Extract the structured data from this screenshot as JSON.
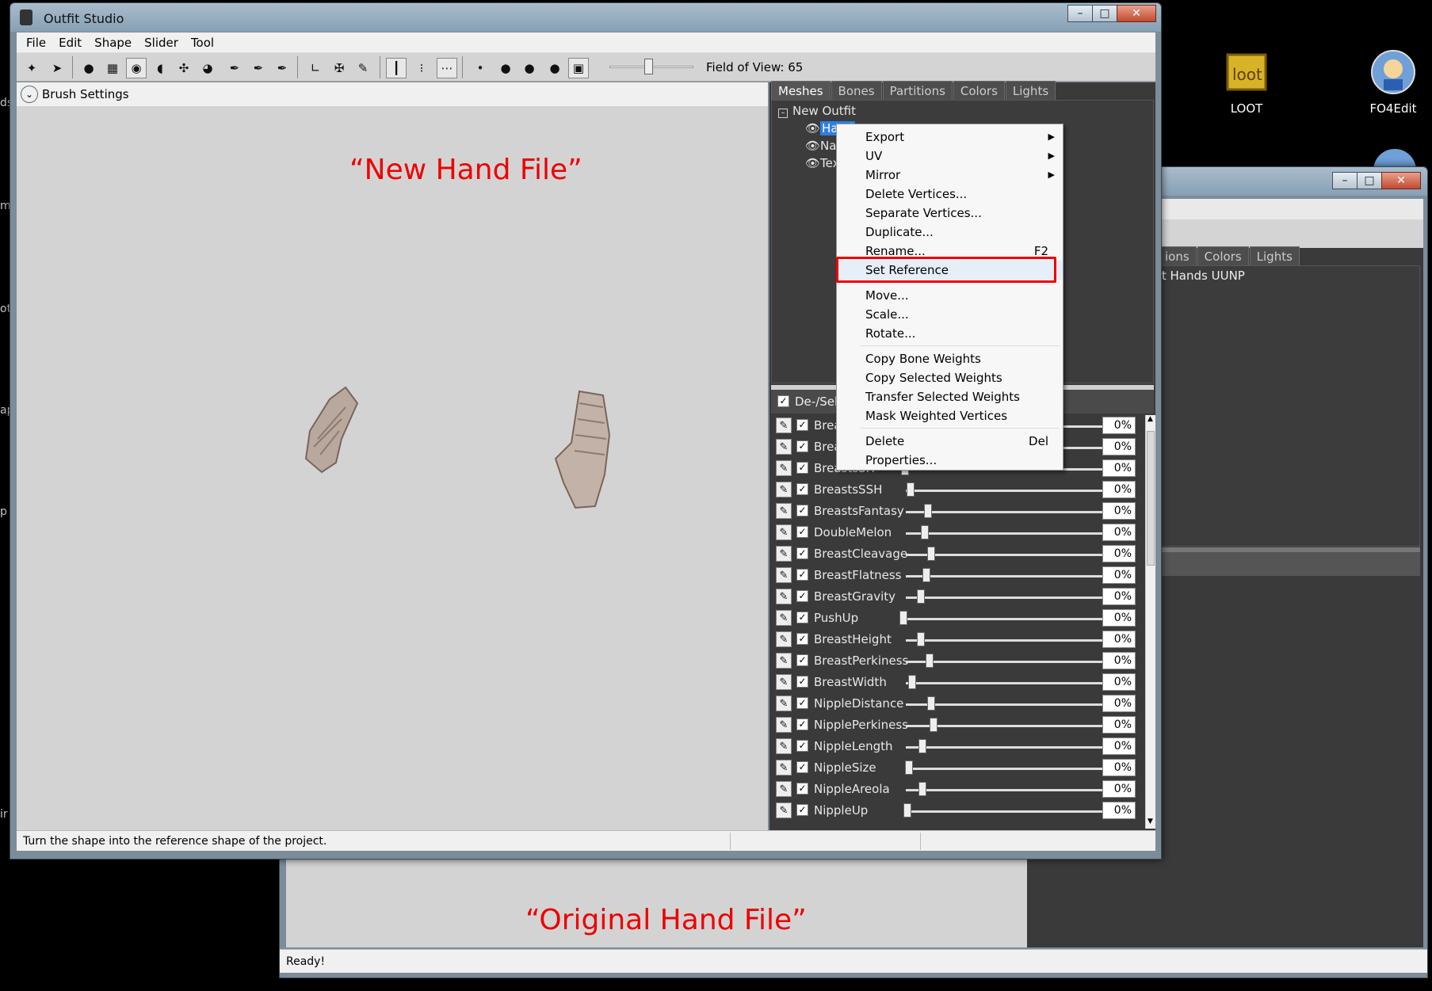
{
  "desktop": {
    "icons": [
      {
        "label": "LOOT"
      },
      {
        "label": "FO4Edit"
      }
    ],
    "edge_fragments": [
      "ds",
      "m",
      "ot",
      "ap",
      "p",
      "ir"
    ]
  },
  "main_window": {
    "title": "Outfit Studio",
    "menu": [
      "File",
      "Edit",
      "Shape",
      "Slider",
      "Tool"
    ],
    "field_of_view": "Field of View: 65",
    "field_of_view_value": 65,
    "brush_settings": "Brush Settings",
    "annotation": "“New Hand File”",
    "status_text": "Turn the shape into the reference shape of the project.",
    "tabs": [
      "Meshes",
      "Bones",
      "Partitions",
      "Colors",
      "Lights"
    ],
    "active_tab": "Meshes",
    "tree": {
      "root": "New Outfit",
      "items": [
        "Hand",
        "Nai",
        "Tex"
      ]
    },
    "select_all_label": "De-/Sele",
    "sliders": [
      {
        "name": "Breas",
        "value": "0%"
      },
      {
        "name": "Breas",
        "value": "0%"
      },
      {
        "name": "BreastsSH",
        "value": "0%"
      },
      {
        "name": "BreastsSSH",
        "value": "0%"
      },
      {
        "name": "BreastsFantasy",
        "value": "0%"
      },
      {
        "name": "DoubleMelon",
        "value": "0%"
      },
      {
        "name": "BreastCleavage",
        "value": "0%"
      },
      {
        "name": "BreastFlatness",
        "value": "0%"
      },
      {
        "name": "BreastGravity",
        "value": "0%"
      },
      {
        "name": "PushUp",
        "value": "0%"
      },
      {
        "name": "BreastHeight",
        "value": "0%"
      },
      {
        "name": "BreastPerkiness",
        "value": "0%"
      },
      {
        "name": "BreastWidth",
        "value": "0%"
      },
      {
        "name": "NippleDistance",
        "value": "0%"
      },
      {
        "name": "NipplePerkiness",
        "value": "0%"
      },
      {
        "name": "NippleLength",
        "value": "0%"
      },
      {
        "name": "NippleSize",
        "value": "0%"
      },
      {
        "name": "NippleAreola",
        "value": "0%"
      },
      {
        "name": "NippleUp",
        "value": "0%"
      }
    ]
  },
  "context_menu": {
    "items": [
      {
        "label": "Export",
        "submenu": true
      },
      {
        "label": "UV",
        "submenu": true
      },
      {
        "label": "Mirror",
        "submenu": true
      },
      {
        "label": "Delete Vertices..."
      },
      {
        "label": "Separate Vertices..."
      },
      {
        "label": "Duplicate..."
      },
      {
        "label": "Rename...",
        "shortcut": "F2"
      },
      {
        "label": "Set Reference",
        "highlighted": true
      },
      {
        "label": "Move..."
      },
      {
        "label": "Scale..."
      },
      {
        "label": "Rotate..."
      },
      {
        "label": "Copy Bone Weights"
      },
      {
        "label": "Copy Selected Weights"
      },
      {
        "label": "Transfer Selected Weights"
      },
      {
        "label": "Mask Weighted Vertices"
      },
      {
        "label": "Delete",
        "shortcut": "Del"
      },
      {
        "label": "Properties..."
      }
    ]
  },
  "back_window": {
    "tabs": [
      "ions",
      "Colors",
      "Lights"
    ],
    "tree_item": "xt Hands UUNP",
    "annotation": "“Original Hand File”",
    "status_text": "Ready!"
  },
  "colors": {
    "highlight": "#e00000",
    "selection": "#2f7fe0",
    "panel_dark": "#3c3c3c"
  }
}
